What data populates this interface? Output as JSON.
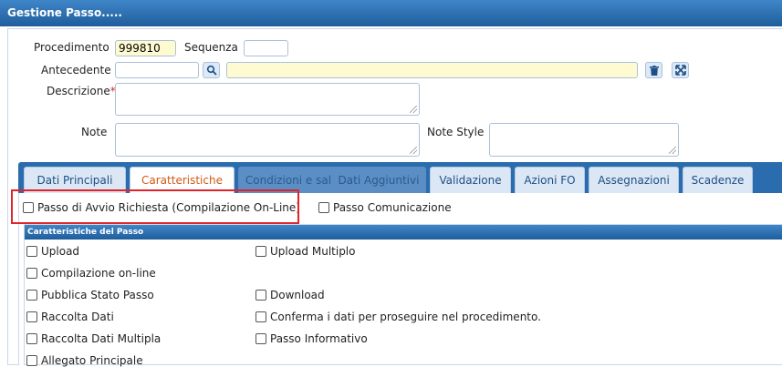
{
  "window": {
    "title": "Gestione Passo....."
  },
  "form": {
    "procedimento_label": "Procedimento",
    "procedimento_value": "999810",
    "sequenza_label": "Sequenza",
    "sequenza_value": "",
    "antecedente_label": "Antecedente",
    "antecedente_code": "",
    "antecedente_desc": "",
    "descrizione_label": "Descrizione",
    "required_mark": "*",
    "descrizione_value": "",
    "note_label": "Note",
    "note_value": "",
    "note_style_label": "Note Style",
    "note_style_value": ""
  },
  "tabs": [
    {
      "label": "Dati Principali",
      "state": "normal"
    },
    {
      "label": "Caratteristiche",
      "state": "active"
    },
    {
      "label": "Condizioni e salti",
      "state": "disabled"
    },
    {
      "label": "Dati Aggiuntivi",
      "state": "disabled"
    },
    {
      "label": "Validazione",
      "state": "normal"
    },
    {
      "label": "Azioni FO",
      "state": "normal"
    },
    {
      "label": "Assegnazioni",
      "state": "normal"
    },
    {
      "label": "Scadenze",
      "state": "normal"
    }
  ],
  "top_options": {
    "avvio_richiesta": "Passo di Avvio Richiesta (Compilazione On-Line)",
    "comunicazione": "Passo Comunicazione"
  },
  "section": {
    "title": "Caratteristiche del Passo",
    "left": [
      "Upload",
      "Compilazione on-line",
      "Pubblica Stato Passo",
      "Raccolta Dati",
      "Raccolta Dati Multipla",
      "Allegato Principale"
    ],
    "right": [
      "Upload Multiplo",
      "",
      "Download",
      "Conferma i dati per proseguire nel procedimento.",
      "Passo Informativo",
      ""
    ]
  },
  "colors": {
    "titlebar": "#2a6cad",
    "highlight_border": "#e0242a",
    "active_tab_text": "#d05a14"
  }
}
